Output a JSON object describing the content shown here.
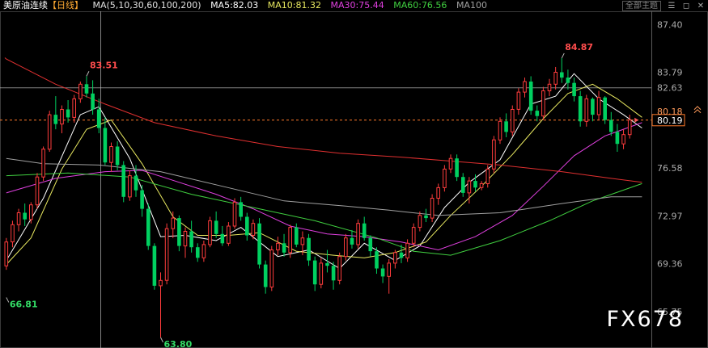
{
  "header": {
    "name": "美原油连续",
    "period": "【日线】",
    "ma_label": "MA(5,10,30,60,100,200)",
    "ma5": "MA5:82.03",
    "ma10": "MA10:81.32",
    "ma30": "MA30:75.44",
    "ma60": "MA60:76.56",
    "ma100": "MA100"
  },
  "toolbar": {
    "theme_select": "全部主题",
    "icons": [
      "bars-icon",
      "window-icon",
      "close-icon"
    ]
  },
  "watermark": "FX678",
  "colors": {
    "up": "#ff3c3c",
    "down": "#00d060",
    "ma5": "#ffffff",
    "ma10": "#e8e860",
    "ma30": "#e040e0",
    "ma60": "#40d040",
    "ma100": "#a0a0a0",
    "ma200": "#e03030"
  },
  "chart_data": {
    "type": "candlestick",
    "ylim": [
      63.0,
      88.4
    ],
    "yticks": [
      "87.40",
      "83.79",
      "82.63",
      "80.19",
      "76.58",
      "72.97",
      "69.36",
      "65.75"
    ],
    "price_labels": {
      "last": "80.19",
      "ref": "80.18"
    },
    "annotations": [
      {
        "text": "83.51",
        "kind": "high"
      },
      {
        "text": "66.81",
        "kind": "low"
      },
      {
        "text": "63.80",
        "kind": "low"
      },
      {
        "text": "84.87",
        "kind": "high"
      }
    ],
    "ohlc": [
      [
        69.2,
        71.3,
        68.9,
        71.0
      ],
      [
        71.0,
        72.6,
        70.6,
        72.3
      ],
      [
        72.3,
        73.5,
        71.8,
        73.2
      ],
      [
        73.2,
        73.9,
        72.2,
        72.7
      ],
      [
        72.7,
        74.0,
        72.4,
        73.8
      ],
      [
        73.8,
        76.2,
        73.5,
        75.9
      ],
      [
        75.9,
        78.2,
        75.6,
        78.0
      ],
      [
        78.0,
        80.9,
        77.8,
        80.6
      ],
      [
        80.6,
        82.0,
        79.5,
        79.9
      ],
      [
        79.9,
        81.3,
        79.2,
        81.0
      ],
      [
        81.0,
        81.7,
        80.0,
        80.4
      ],
      [
        80.4,
        82.1,
        80.0,
        81.8
      ],
      [
        81.8,
        83.1,
        81.5,
        82.9
      ],
      [
        82.9,
        83.51,
        81.9,
        82.2
      ],
      [
        82.2,
        83.2,
        80.6,
        81.0
      ],
      [
        81.0,
        81.8,
        79.2,
        79.6
      ],
      [
        79.6,
        80.4,
        76.8,
        77.0
      ],
      [
        77.0,
        78.5,
        76.3,
        78.2
      ],
      [
        78.2,
        78.6,
        76.4,
        76.8
      ],
      [
        76.8,
        77.1,
        74.0,
        74.4
      ],
      [
        74.4,
        76.4,
        74.1,
        76.0
      ],
      [
        76.0,
        76.8,
        74.4,
        74.9
      ],
      [
        74.9,
        75.3,
        72.9,
        73.5
      ],
      [
        73.5,
        73.9,
        70.4,
        70.7
      ],
      [
        70.7,
        70.9,
        67.4,
        67.7
      ],
      [
        67.7,
        68.7,
        63.8,
        68.1
      ],
      [
        68.1,
        72.4,
        67.8,
        72.0
      ],
      [
        72.0,
        73.3,
        71.3,
        72.8
      ],
      [
        72.8,
        73.0,
        70.3,
        70.7
      ],
      [
        70.7,
        72.1,
        69.8,
        71.8
      ],
      [
        71.8,
        72.6,
        70.2,
        70.6
      ],
      [
        70.6,
        70.9,
        69.5,
        69.8
      ],
      [
        69.8,
        71.1,
        69.5,
        70.8
      ],
      [
        70.8,
        72.9,
        70.6,
        72.6
      ],
      [
        72.6,
        73.3,
        71.3,
        71.6
      ],
      [
        71.6,
        72.2,
        70.7,
        70.9
      ],
      [
        70.9,
        72.5,
        70.7,
        72.2
      ],
      [
        72.2,
        74.3,
        72.0,
        74.0
      ],
      [
        74.0,
        74.4,
        72.6,
        72.9
      ],
      [
        72.9,
        73.2,
        71.1,
        71.5
      ],
      [
        71.5,
        72.7,
        71.2,
        72.4
      ],
      [
        72.4,
        72.8,
        69.0,
        69.3
      ],
      [
        69.3,
        69.6,
        67.1,
        67.6
      ],
      [
        67.6,
        70.7,
        67.3,
        70.4
      ],
      [
        70.4,
        71.4,
        70.0,
        70.9
      ],
      [
        70.9,
        71.6,
        69.9,
        70.2
      ],
      [
        70.2,
        72.3,
        69.8,
        72.1
      ],
      [
        72.1,
        72.4,
        70.6,
        70.8
      ],
      [
        70.8,
        71.8,
        70.0,
        71.3
      ],
      [
        71.3,
        71.6,
        69.2,
        69.6
      ],
      [
        69.6,
        69.9,
        67.3,
        67.8
      ],
      [
        67.8,
        69.8,
        67.5,
        69.4
      ],
      [
        69.4,
        70.4,
        68.7,
        69.2
      ],
      [
        69.2,
        69.5,
        67.4,
        68.1
      ],
      [
        68.1,
        70.2,
        67.8,
        69.9
      ],
      [
        69.9,
        71.6,
        69.6,
        71.3
      ],
      [
        71.3,
        71.9,
        70.5,
        70.8
      ],
      [
        70.8,
        72.7,
        70.5,
        72.4
      ],
      [
        72.4,
        72.9,
        71.1,
        71.3
      ],
      [
        71.3,
        71.5,
        69.9,
        70.3
      ],
      [
        70.3,
        70.6,
        68.6,
        69.0
      ],
      [
        69.0,
        69.3,
        67.9,
        68.4
      ],
      [
        68.4,
        69.7,
        67.1,
        69.4
      ],
      [
        69.4,
        70.4,
        69.0,
        70.2
      ],
      [
        70.2,
        70.8,
        69.4,
        69.8
      ],
      [
        69.8,
        71.2,
        69.5,
        70.9
      ],
      [
        70.9,
        72.4,
        70.6,
        72.1
      ],
      [
        72.1,
        73.3,
        71.8,
        73.0
      ],
      [
        73.0,
        73.5,
        72.5,
        72.8
      ],
      [
        72.8,
        74.6,
        72.5,
        74.3
      ],
      [
        74.3,
        75.4,
        73.8,
        75.1
      ],
      [
        75.1,
        76.8,
        74.8,
        76.5
      ],
      [
        76.5,
        77.6,
        76.2,
        77.3
      ],
      [
        77.3,
        77.6,
        75.6,
        75.9
      ],
      [
        75.9,
        76.2,
        74.4,
        74.7
      ],
      [
        74.7,
        75.9,
        73.9,
        75.6
      ],
      [
        75.6,
        76.1,
        74.8,
        75.1
      ],
      [
        75.1,
        75.6,
        74.9,
        75.4
      ],
      [
        75.4,
        76.8,
        75.1,
        76.5
      ],
      [
        76.5,
        79.0,
        76.2,
        78.7
      ],
      [
        78.7,
        80.4,
        78.4,
        80.1
      ],
      [
        80.1,
        80.7,
        78.9,
        79.3
      ],
      [
        79.3,
        81.3,
        79.0,
        81.0
      ],
      [
        81.0,
        82.6,
        80.6,
        82.3
      ],
      [
        82.3,
        83.4,
        81.9,
        83.1
      ],
      [
        83.1,
        83.5,
        80.6,
        80.9
      ],
      [
        80.9,
        81.3,
        80.1,
        80.5
      ],
      [
        80.5,
        82.7,
        80.2,
        82.4
      ],
      [
        82.4,
        83.3,
        82.0,
        82.9
      ],
      [
        82.9,
        84.2,
        82.5,
        83.8
      ],
      [
        83.8,
        84.87,
        83.0,
        83.4
      ],
      [
        83.4,
        84.0,
        82.5,
        83.0
      ],
      [
        83.0,
        83.4,
        81.6,
        82.0
      ],
      [
        82.0,
        82.4,
        79.7,
        80.1
      ],
      [
        80.1,
        82.1,
        79.7,
        81.8
      ],
      [
        81.8,
        81.9,
        80.1,
        80.6
      ],
      [
        80.6,
        82.4,
        80.2,
        81.9
      ],
      [
        81.9,
        82.0,
        79.9,
        80.2
      ],
      [
        80.2,
        80.8,
        79.0,
        79.3
      ],
      [
        79.3,
        79.9,
        77.8,
        78.4
      ],
      [
        78.4,
        79.5,
        78.0,
        79.1
      ],
      [
        79.1,
        80.6,
        78.8,
        80.2
      ]
    ],
    "ma": {
      "ma5": {
        "anchors": [
          [
            0,
            69.6
          ],
          [
            6,
            74.3
          ],
          [
            12,
            80.6
          ],
          [
            15,
            81.2
          ],
          [
            20,
            77.3
          ],
          [
            25,
            71.4
          ],
          [
            29,
            71.5
          ],
          [
            34,
            71.1
          ],
          [
            38,
            72.1
          ],
          [
            44,
            69.9
          ],
          [
            49,
            70.4
          ],
          [
            54,
            69.0
          ],
          [
            58,
            70.9
          ],
          [
            63,
            69.6
          ],
          [
            67,
            70.7
          ],
          [
            71,
            73.6
          ],
          [
            75,
            75.5
          ],
          [
            80,
            77.2
          ],
          [
            85,
            81.4
          ],
          [
            89,
            82.0
          ],
          [
            92,
            83.7
          ],
          [
            96,
            81.8
          ],
          [
            100,
            80.6
          ],
          [
            103,
            79.6
          ]
        ]
      },
      "ma10": {
        "anchors": [
          [
            0,
            69.3
          ],
          [
            4,
            71.3
          ],
          [
            9,
            76.5
          ],
          [
            13,
            79.5
          ],
          [
            17,
            80.2
          ],
          [
            22,
            76.9
          ],
          [
            27,
            72.9
          ],
          [
            31,
            71.5
          ],
          [
            36,
            71.5
          ],
          [
            41,
            71.7
          ],
          [
            47,
            70.3
          ],
          [
            53,
            70.0
          ],
          [
            58,
            69.8
          ],
          [
            63,
            70.2
          ],
          [
            68,
            71.0
          ],
          [
            72,
            73.0
          ],
          [
            77,
            75.2
          ],
          [
            82,
            77.6
          ],
          [
            87,
            80.3
          ],
          [
            91,
            82.2
          ],
          [
            95,
            82.9
          ],
          [
            99,
            81.8
          ],
          [
            103,
            80.4
          ]
        ]
      },
      "ma30": {
        "anchors": [
          [
            0,
            74.7
          ],
          [
            8,
            75.8
          ],
          [
            16,
            76.3
          ],
          [
            22,
            76.4
          ],
          [
            28,
            75.5
          ],
          [
            34,
            74.6
          ],
          [
            40,
            73.5
          ],
          [
            46,
            72.2
          ],
          [
            52,
            71.6
          ],
          [
            58,
            71.4
          ],
          [
            64,
            71.0
          ],
          [
            70,
            70.4
          ],
          [
            76,
            71.4
          ],
          [
            82,
            73.0
          ],
          [
            87,
            75.2
          ],
          [
            92,
            77.5
          ],
          [
            97,
            79.0
          ],
          [
            103,
            80.0
          ]
        ]
      },
      "ma60": {
        "anchors": [
          [
            0,
            76.0
          ],
          [
            10,
            76.2
          ],
          [
            20,
            75.9
          ],
          [
            30,
            74.6
          ],
          [
            40,
            73.6
          ],
          [
            50,
            72.6
          ],
          [
            60,
            71.3
          ],
          [
            66,
            70.3
          ],
          [
            72,
            70.0
          ],
          [
            80,
            71.1
          ],
          [
            88,
            72.6
          ],
          [
            95,
            74.1
          ],
          [
            103,
            75.4
          ]
        ]
      },
      "ma100": {
        "anchors": [
          [
            0,
            77.3
          ],
          [
            6,
            76.9
          ],
          [
            15,
            76.8
          ],
          [
            25,
            76.3
          ],
          [
            35,
            75.2
          ],
          [
            45,
            74.1
          ],
          [
            55,
            73.7
          ],
          [
            62,
            73.4
          ],
          [
            70,
            73.0
          ],
          [
            80,
            73.2
          ],
          [
            90,
            73.9
          ],
          [
            98,
            74.4
          ],
          [
            103,
            74.4
          ]
        ]
      },
      "ma200": {
        "anchors": [
          [
            0,
            84.8
          ],
          [
            8,
            82.9
          ],
          [
            16,
            81.4
          ],
          [
            24,
            80.0
          ],
          [
            34,
            79.0
          ],
          [
            44,
            78.2
          ],
          [
            54,
            77.7
          ],
          [
            64,
            77.4
          ],
          [
            72,
            77.1
          ],
          [
            80,
            76.8
          ],
          [
            90,
            76.3
          ],
          [
            98,
            75.8
          ],
          [
            103,
            75.5
          ]
        ]
      }
    }
  }
}
